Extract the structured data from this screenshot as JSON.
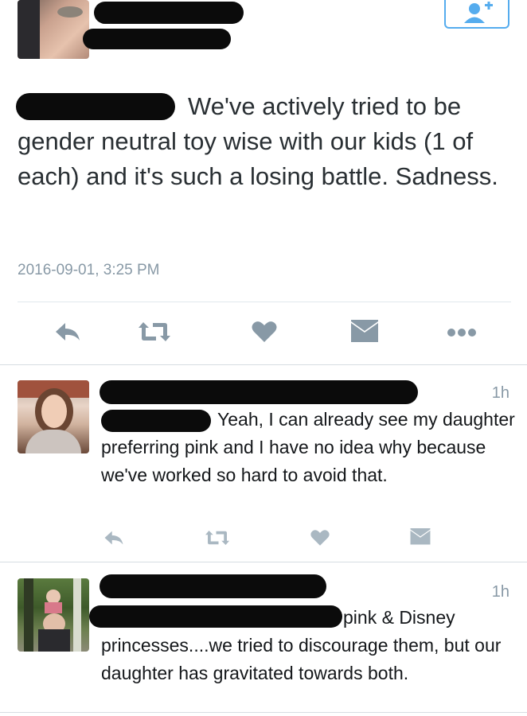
{
  "main_tweet": {
    "text": "We've actively tried to be gender neutral toy wise with our kids (1 of each) and it's such a losing battle. Sadness.",
    "timestamp": "2016-09-01, 3:25 PM"
  },
  "actions": {
    "reply_icon": "reply-icon",
    "retweet_icon": "retweet-icon",
    "like_icon": "heart-icon",
    "dm_icon": "envelope-icon",
    "more_icon": "more-dots-icon",
    "follow_icon": "add-user-icon"
  },
  "replies": [
    {
      "time": "1h",
      "text": "Yeah, I can already see my daughter preferring pink and I have no idea why because we've worked so hard to avoid that."
    },
    {
      "time": "1h",
      "text": "pink & Disney princesses....we tried to discourage them, but our daughter has gravitated towards both."
    }
  ],
  "colors": {
    "accent": "#55acee",
    "icon": "#8899a6",
    "text": "#14171a",
    "divider": "#e1e8ed"
  }
}
